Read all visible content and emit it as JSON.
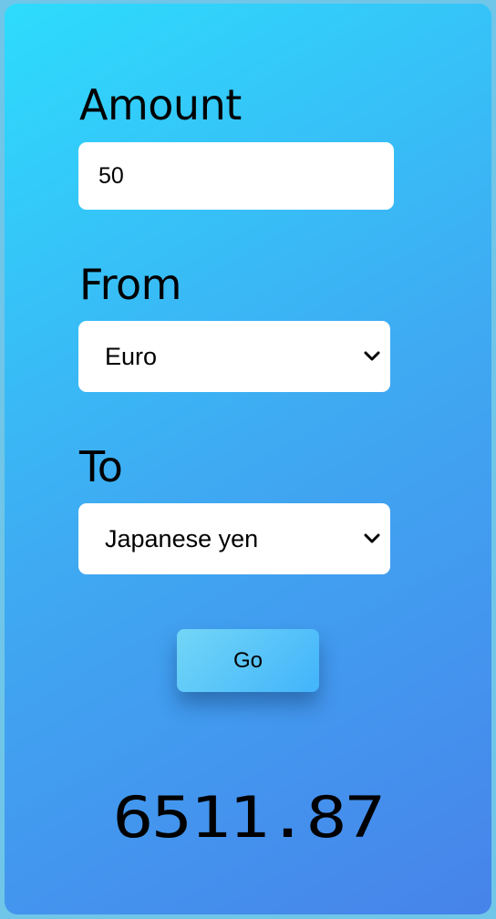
{
  "form": {
    "amount_label": "Amount",
    "amount_value": "50",
    "from_label": "From",
    "from_selected": "Euro",
    "to_label": "To",
    "to_selected": "Japanese yen",
    "go_label": "Go"
  },
  "result": {
    "value": "6511.87"
  },
  "icons": {
    "select_arrow": "chevron-down-icon"
  },
  "colors": {
    "gradient_start": "#2ddcfd",
    "gradient_mid": "#3fa9f2",
    "gradient_end": "#4783ea",
    "button_start": "#72d6f6",
    "button_end": "#42b4fb"
  }
}
